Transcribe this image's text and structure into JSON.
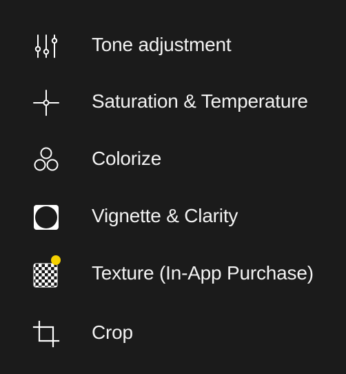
{
  "menu": {
    "items": [
      {
        "label": "Tone adjustment",
        "icon": "sliders-icon"
      },
      {
        "label": "Saturation & Temperature",
        "icon": "crosshair-icon"
      },
      {
        "label": "Colorize",
        "icon": "three-circles-icon"
      },
      {
        "label": "Vignette & Clarity",
        "icon": "vignette-icon"
      },
      {
        "label": "Texture (In-App Purchase)",
        "icon": "checkerboard-icon",
        "badge_color": "#f5d100"
      },
      {
        "label": "Crop",
        "icon": "crop-icon"
      }
    ]
  },
  "colors": {
    "background": "#1b1b1b",
    "text": "#f2f2f2",
    "icon": "#ffffff",
    "badge": "#f5d100"
  }
}
